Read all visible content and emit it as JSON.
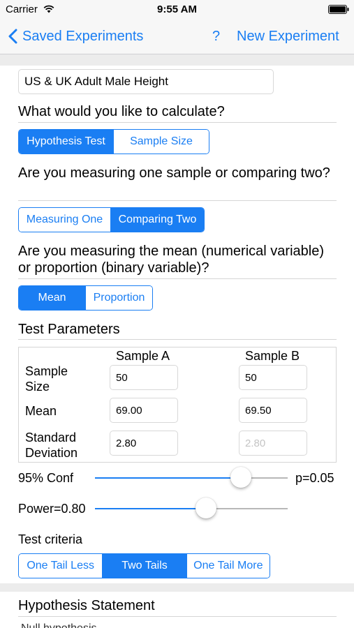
{
  "status_bar": {
    "carrier": "Carrier",
    "time": "9:55 AM",
    "wifi_icon": "wifi-icon",
    "battery_icon": "battery-icon"
  },
  "nav": {
    "back_label": "Saved Experiments",
    "help_label": "?",
    "new_label": "New Experiment",
    "accent": "#1a7ef3"
  },
  "experiment": {
    "title_value": "US & UK Adult Male Height"
  },
  "calc": {
    "question": "What would you like to calculate?",
    "options": [
      "Hypothesis Test",
      "Sample Size"
    ],
    "selected": "Hypothesis Test"
  },
  "samples": {
    "question": "Are you measuring one sample or comparing two?",
    "options": [
      "Measuring One",
      "Comparing Two"
    ],
    "selected": "Comparing Two"
  },
  "variable": {
    "question": "Are you measuring the mean (numerical variable) or proportion (binary variable)?",
    "options": [
      "Mean",
      "Proportion"
    ],
    "selected": "Mean"
  },
  "params": {
    "heading": "Test Parameters",
    "col_a": "Sample A",
    "col_b": "Sample B",
    "rows": [
      {
        "label": "Sample Size",
        "a": "50",
        "b": "50"
      },
      {
        "label": "Mean",
        "a": "69.00",
        "b": "69.50"
      },
      {
        "label": "Standard Deviation",
        "a": "2.80",
        "b": "2.80"
      }
    ]
  },
  "confidence": {
    "label": "95% Conf",
    "p_label": "p=0.05",
    "value": 0.95
  },
  "power": {
    "label": "Power=0.80",
    "value": 0.8
  },
  "criteria": {
    "heading": "Test criteria",
    "options": [
      "One Tail Less",
      "Two Tails",
      "One Tail More"
    ],
    "selected": "Two Tails"
  },
  "hypothesis": {
    "heading": "Hypothesis Statement",
    "partial_text": "Null hypothesis"
  }
}
